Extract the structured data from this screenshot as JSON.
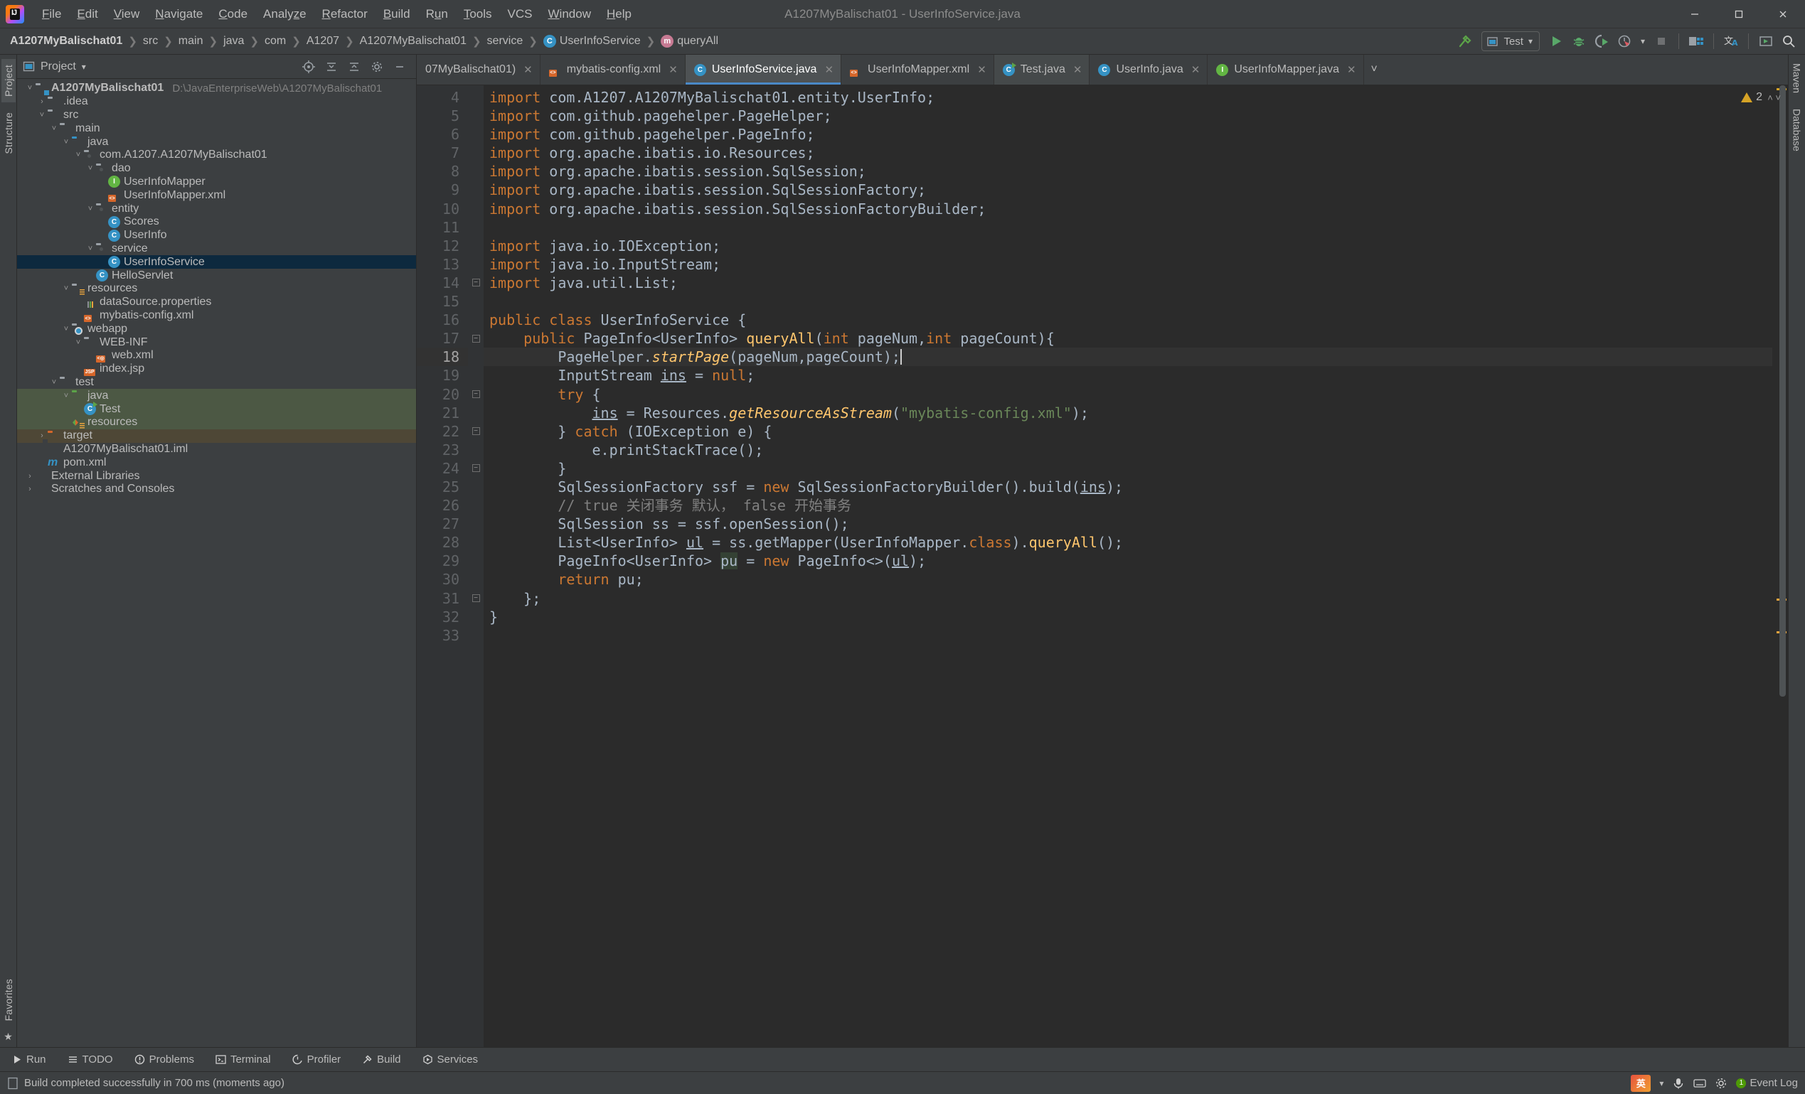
{
  "window": {
    "title": "A1207MyBalischat01 - UserInfoService.java",
    "app_icon": "intellij-idea-logo",
    "controls": {
      "minimize": "─",
      "maximize": "☐",
      "close": "✕"
    }
  },
  "menubar": [
    {
      "label": "File",
      "mnemonic": "F"
    },
    {
      "label": "Edit",
      "mnemonic": "E"
    },
    {
      "label": "View",
      "mnemonic": "V"
    },
    {
      "label": "Navigate",
      "mnemonic": "N"
    },
    {
      "label": "Code",
      "mnemonic": "C"
    },
    {
      "label": "Analyze",
      "mnemonic": "z"
    },
    {
      "label": "Refactor",
      "mnemonic": "R"
    },
    {
      "label": "Build",
      "mnemonic": "B"
    },
    {
      "label": "Run",
      "mnemonic": "u"
    },
    {
      "label": "Tools",
      "mnemonic": "T"
    },
    {
      "label": "VCS",
      "mnemonic": ""
    },
    {
      "label": "Window",
      "mnemonic": "W"
    },
    {
      "label": "Help",
      "mnemonic": "H"
    }
  ],
  "breadcrumb": [
    {
      "label": "A1207MyBalischat01",
      "bold": true,
      "icon": ""
    },
    {
      "label": "src",
      "bold": false,
      "icon": ""
    },
    {
      "label": "main",
      "bold": false,
      "icon": ""
    },
    {
      "label": "java",
      "bold": false,
      "icon": ""
    },
    {
      "label": "com",
      "bold": false,
      "icon": ""
    },
    {
      "label": "A1207",
      "bold": false,
      "icon": ""
    },
    {
      "label": "A1207MyBalischat01",
      "bold": false,
      "icon": ""
    },
    {
      "label": "service",
      "bold": false,
      "icon": ""
    },
    {
      "label": "UserInfoService",
      "bold": false,
      "icon": "class-icon"
    },
    {
      "label": "queryAll",
      "bold": false,
      "icon": "method-icon"
    }
  ],
  "toolbar": {
    "build_icon": "hammer-icon",
    "run_config_label": "Test",
    "run_config_icon": "application-icon",
    "dropdown_caret": "▾",
    "run_icon": "run-play-icon",
    "debug_icon": "debug-bug-icon",
    "coverage_icon": "run-with-coverage-icon",
    "profile_icon": "profiler-icon",
    "stop_icon": "stop-icon",
    "updates_icon": "project-structure-icon",
    "translate_icon": "translate-icon",
    "console_icon": "console-icon",
    "search_icon": "search-everywhere-icon"
  },
  "left_rail": {
    "top": [
      "Project",
      "Structure"
    ],
    "bottom": [
      "Favorites"
    ],
    "active": "Project"
  },
  "right_rail": [
    "Maven",
    "Database"
  ],
  "project_panel": {
    "title": "Project",
    "title_caret": "▾",
    "header_icons": [
      "target-icon",
      "expand-all-icon",
      "collapse-all-icon",
      "settings-gear-icon",
      "hide-icon"
    ],
    "tree": [
      {
        "depth": 0,
        "twist": "˅",
        "icon": "module-folder-icon",
        "label": "A1207MyBalischat01",
        "bold": true,
        "path": "D:\\JavaEnterpriseWeb\\A1207MyBalischat01",
        "state": ""
      },
      {
        "depth": 1,
        "twist": "›",
        "icon": "folder-icon",
        "label": ".idea",
        "bold": false,
        "path": "",
        "state": ""
      },
      {
        "depth": 1,
        "twist": "˅",
        "icon": "folder-icon",
        "label": "src",
        "bold": false,
        "path": "",
        "state": ""
      },
      {
        "depth": 2,
        "twist": "˅",
        "icon": "folder-icon",
        "label": "main",
        "bold": false,
        "path": "",
        "state": ""
      },
      {
        "depth": 3,
        "twist": "˅",
        "icon": "source-folder-icon",
        "label": "java",
        "bold": false,
        "path": "",
        "state": ""
      },
      {
        "depth": 4,
        "twist": "˅",
        "icon": "package-icon",
        "label": "com.A1207.A1207MyBalischat01",
        "bold": false,
        "path": "",
        "state": ""
      },
      {
        "depth": 5,
        "twist": "˅",
        "icon": "package-icon",
        "label": "dao",
        "bold": false,
        "path": "",
        "state": ""
      },
      {
        "depth": 6,
        "twist": "",
        "icon": "interface-icon",
        "label": "UserInfoMapper",
        "bold": false,
        "path": "",
        "state": ""
      },
      {
        "depth": 6,
        "twist": "",
        "icon": "xml-file-icon",
        "label": "UserInfoMapper.xml",
        "bold": false,
        "path": "",
        "state": ""
      },
      {
        "depth": 5,
        "twist": "˅",
        "icon": "package-icon",
        "label": "entity",
        "bold": false,
        "path": "",
        "state": ""
      },
      {
        "depth": 6,
        "twist": "",
        "icon": "class-icon",
        "label": "Scores",
        "bold": false,
        "path": "",
        "state": ""
      },
      {
        "depth": 6,
        "twist": "",
        "icon": "class-icon",
        "label": "UserInfo",
        "bold": false,
        "path": "",
        "state": ""
      },
      {
        "depth": 5,
        "twist": "˅",
        "icon": "package-icon",
        "label": "service",
        "bold": false,
        "path": "",
        "state": ""
      },
      {
        "depth": 6,
        "twist": "",
        "icon": "class-icon",
        "label": "UserInfoService",
        "bold": false,
        "path": "",
        "state": "selected"
      },
      {
        "depth": 5,
        "twist": "",
        "icon": "class-icon",
        "label": "HelloServlet",
        "bold": false,
        "path": "",
        "state": ""
      },
      {
        "depth": 3,
        "twist": "˅",
        "icon": "resources-folder-icon",
        "label": "resources",
        "bold": false,
        "path": "",
        "state": ""
      },
      {
        "depth": 4,
        "twist": "",
        "icon": "properties-file-icon",
        "label": "dataSource.properties",
        "bold": false,
        "path": "",
        "state": ""
      },
      {
        "depth": 4,
        "twist": "",
        "icon": "xml-file-icon",
        "label": "mybatis-config.xml",
        "bold": false,
        "path": "",
        "state": ""
      },
      {
        "depth": 3,
        "twist": "˅",
        "icon": "webapp-folder-icon",
        "label": "webapp",
        "bold": false,
        "path": "",
        "state": ""
      },
      {
        "depth": 4,
        "twist": "˅",
        "icon": "folder-icon",
        "label": "WEB-INF",
        "bold": false,
        "path": "",
        "state": ""
      },
      {
        "depth": 5,
        "twist": "",
        "icon": "web-xml-file-icon",
        "label": "web.xml",
        "bold": false,
        "path": "",
        "state": ""
      },
      {
        "depth": 4,
        "twist": "",
        "icon": "jsp-file-icon",
        "label": "index.jsp",
        "bold": false,
        "path": "",
        "state": ""
      },
      {
        "depth": 2,
        "twist": "˅",
        "icon": "folder-icon",
        "label": "test",
        "bold": false,
        "path": "",
        "state": ""
      },
      {
        "depth": 3,
        "twist": "˅",
        "icon": "test-source-folder-icon",
        "label": "java",
        "bold": false,
        "path": "",
        "state": "green"
      },
      {
        "depth": 4,
        "twist": "",
        "icon": "test-class-icon",
        "label": "Test",
        "bold": false,
        "path": "",
        "state": "green"
      },
      {
        "depth": 3,
        "twist": "",
        "icon": "test-resources-folder-icon",
        "label": "resources",
        "bold": false,
        "path": "",
        "state": "green"
      },
      {
        "depth": 1,
        "twist": "›",
        "icon": "excluded-folder-icon",
        "label": "target",
        "bold": false,
        "path": "",
        "state": "brown"
      },
      {
        "depth": 1,
        "twist": "",
        "icon": "iml-file-icon",
        "label": "A1207MyBalischat01.iml",
        "bold": false,
        "path": "",
        "state": ""
      },
      {
        "depth": 1,
        "twist": "",
        "icon": "maven-pom-icon",
        "label": "pom.xml",
        "bold": false,
        "path": "",
        "state": ""
      },
      {
        "depth": 0,
        "twist": "›",
        "icon": "external-libraries-icon",
        "label": "External Libraries",
        "bold": false,
        "path": "",
        "state": ""
      },
      {
        "depth": 0,
        "twist": "›",
        "icon": "scratches-icon",
        "label": "Scratches and Consoles",
        "bold": false,
        "path": "",
        "state": ""
      }
    ]
  },
  "editor_tabs": {
    "items": [
      {
        "label": "07MyBalischat01)",
        "icon": "",
        "active": false,
        "truncated": true
      },
      {
        "label": "mybatis-config.xml",
        "icon": "xml-file-icon",
        "active": false,
        "truncated": false
      },
      {
        "label": "UserInfoService.java",
        "icon": "class-icon",
        "active": true,
        "truncated": false
      },
      {
        "label": "UserInfoMapper.xml",
        "icon": "xml-file-icon",
        "active": false,
        "truncated": false
      },
      {
        "label": "Test.java",
        "icon": "test-class-icon",
        "active": false,
        "truncated": false
      },
      {
        "label": "UserInfo.java",
        "icon": "class-icon",
        "active": false,
        "truncated": false
      },
      {
        "label": "UserInfoMapper.java",
        "icon": "interface-icon",
        "active": false,
        "truncated": false
      }
    ],
    "close_glyph": "✕",
    "overflow_glyph": "˅"
  },
  "editor": {
    "warning_count": "2",
    "warning_icon": "warning-triangle-icon",
    "inspection_up": "˄",
    "inspection_down": "˅",
    "first_line_number": 4,
    "caret_line": 18,
    "lines": [
      {
        "n": 4,
        "fold": "",
        "text": "import com.A1207.A1207MyBalischat01.entity.UserInfo;"
      },
      {
        "n": 5,
        "fold": "",
        "text": "import com.github.pagehelper.PageHelper;"
      },
      {
        "n": 6,
        "fold": "",
        "text": "import com.github.pagehelper.PageInfo;"
      },
      {
        "n": 7,
        "fold": "",
        "text": "import org.apache.ibatis.io.Resources;"
      },
      {
        "n": 8,
        "fold": "",
        "text": "import org.apache.ibatis.session.SqlSession;"
      },
      {
        "n": 9,
        "fold": "",
        "text": "import org.apache.ibatis.session.SqlSessionFactory;"
      },
      {
        "n": 10,
        "fold": "",
        "text": "import org.apache.ibatis.session.SqlSessionFactoryBuilder;"
      },
      {
        "n": 11,
        "fold": "",
        "text": ""
      },
      {
        "n": 12,
        "fold": "",
        "text": "import java.io.IOException;"
      },
      {
        "n": 13,
        "fold": "",
        "text": "import java.io.InputStream;"
      },
      {
        "n": 14,
        "fold": "-",
        "text": "import java.util.List;"
      },
      {
        "n": 15,
        "fold": "",
        "text": ""
      },
      {
        "n": 16,
        "fold": "",
        "text": "public class UserInfoService {"
      },
      {
        "n": 17,
        "fold": "-",
        "text": "    public PageInfo<UserInfo> queryAll(int pageNum,int pageCount){"
      },
      {
        "n": 18,
        "fold": "",
        "text": "        PageHelper.startPage(pageNum,pageCount);"
      },
      {
        "n": 19,
        "fold": "",
        "text": "        InputStream ins = null;"
      },
      {
        "n": 20,
        "fold": "-",
        "text": "        try {"
      },
      {
        "n": 21,
        "fold": "",
        "text": "            ins = Resources.getResourceAsStream(\"mybatis-config.xml\");"
      },
      {
        "n": 22,
        "fold": "-",
        "text": "        } catch (IOException e) {"
      },
      {
        "n": 23,
        "fold": "",
        "text": "            e.printStackTrace();"
      },
      {
        "n": 24,
        "fold": "-",
        "text": "        }"
      },
      {
        "n": 25,
        "fold": "",
        "text": "        SqlSessionFactory ssf = new SqlSessionFactoryBuilder().build(ins);"
      },
      {
        "n": 26,
        "fold": "",
        "text": "        // true 关闭事务 默认， false 开始事务"
      },
      {
        "n": 27,
        "fold": "",
        "text": "        SqlSession ss = ssf.openSession();"
      },
      {
        "n": 28,
        "fold": "",
        "text": "        List<UserInfo> ul = ss.getMapper(UserInfoMapper.class).queryAll();"
      },
      {
        "n": 29,
        "fold": "",
        "text": "        PageInfo<UserInfo> pu = new PageInfo<>(ul);"
      },
      {
        "n": 30,
        "fold": "",
        "text": "        return pu;"
      },
      {
        "n": 31,
        "fold": "-",
        "text": "    };"
      },
      {
        "n": 32,
        "fold": "",
        "text": "}"
      },
      {
        "n": 33,
        "fold": "",
        "text": ""
      }
    ]
  },
  "tool_window_bar": [
    {
      "label": "Run",
      "icon": "run-play-icon"
    },
    {
      "label": "TODO",
      "icon": "todo-list-icon"
    },
    {
      "label": "Problems",
      "icon": "problems-icon"
    },
    {
      "label": "Terminal",
      "icon": "terminal-icon"
    },
    {
      "label": "Profiler",
      "icon": "profiler-icon"
    },
    {
      "label": "Build",
      "icon": "hammer-icon"
    },
    {
      "label": "Services",
      "icon": "services-icon"
    }
  ],
  "statusbar": {
    "icon": "build-status-icon",
    "message": "Build completed successfully in 700 ms (moments ago)",
    "ime_label": "英",
    "ime_caret": "▾",
    "event_log_label": "Event Log",
    "event_log_count": "1"
  }
}
